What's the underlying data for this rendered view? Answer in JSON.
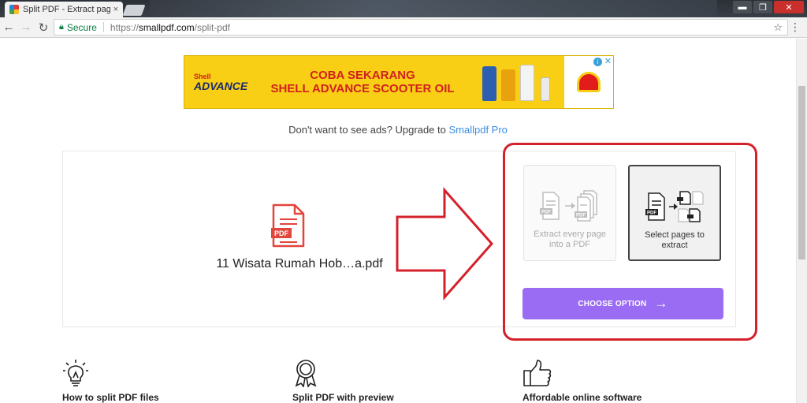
{
  "browser": {
    "tab_title": "Split PDF - Extract pages",
    "tab_close": "×",
    "secure_label": "Secure",
    "url_scheme": "https://",
    "url_host": "smallpdf.com",
    "url_path": "/split-pdf",
    "window_controls": {
      "minimize": "▬",
      "maximize": "❐",
      "close": "✕"
    }
  },
  "ad": {
    "brand_top": "Shell",
    "brand_name": "ADVANCE",
    "headline_1": "COBA SEKARANG",
    "headline_2": "SHELL ADVANCE SCOOTER OIL",
    "info_label": "i",
    "close_label": "✕",
    "colors": {
      "background": "#f8cf15",
      "text": "#d21f1f"
    }
  },
  "upgrade": {
    "text": "Don't want to see ads? Upgrade to ",
    "link": "Smallpdf Pro"
  },
  "file": {
    "icon_label": "PDF",
    "name": "11 Wisata Rumah Hob…a.pdf"
  },
  "options": [
    {
      "label": "Extract every page into a PDF",
      "selected": false,
      "icon_label": "PDF"
    },
    {
      "label": "Select pages to extract",
      "selected": true,
      "icon_label": "PDF"
    }
  ],
  "choose_button": {
    "label": "CHOOSE OPTION",
    "arrow": "→",
    "color": "#9a6cf3"
  },
  "features": [
    {
      "title": "How to split PDF files",
      "icon": "lightbulb-icon"
    },
    {
      "title": "Split PDF with preview",
      "icon": "award-ribbon-icon"
    },
    {
      "title": "Affordable online software",
      "icon": "thumbs-up-icon"
    }
  ],
  "accent_colors": {
    "highlight_red": "#d4212b",
    "link_blue": "#3a8ee6"
  }
}
